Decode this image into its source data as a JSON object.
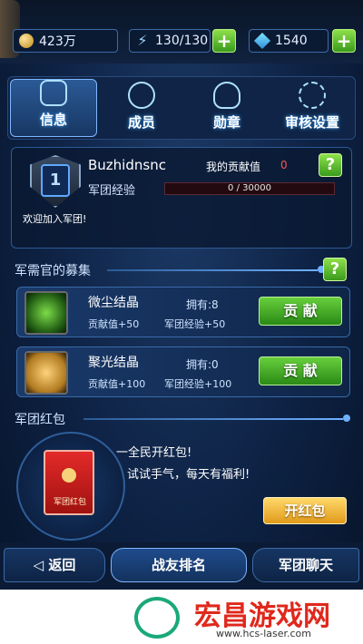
{
  "resources": {
    "gold": "423万",
    "stamina": "130/130",
    "gems": "1540"
  },
  "tabs": [
    {
      "label": "信息",
      "active": true
    },
    {
      "label": "成员",
      "active": false
    },
    {
      "label": "勋章",
      "active": false
    },
    {
      "label": "审核设置",
      "active": false
    }
  ],
  "legion": {
    "level": "1",
    "name": "Buzhidnsnc",
    "contribution_label": "我的贡献值",
    "contribution_value": "0",
    "exp_label": "军团经验",
    "exp_text": "0 / 30000",
    "exp_progress": 0,
    "welcome": "欢迎加入军团!"
  },
  "recruit": {
    "title": "军需官的募集",
    "items": [
      {
        "name": "微尘结晶",
        "owned": "拥有:8",
        "contribution": "贡献值+50",
        "exp": "军团经验+50",
        "button": "贡 献"
      },
      {
        "name": "聚光结晶",
        "owned": "拥有:0",
        "contribution": "贡献值+100",
        "exp": "军团经验+100",
        "button": "贡 献"
      }
    ]
  },
  "red_packet": {
    "title": "军团红包",
    "bag_label": "军团红包",
    "line1": "一全民开红包!",
    "line2": "试试手气，每天有福利!",
    "button": "开红包"
  },
  "bottom_nav": {
    "back": "返回",
    "ranking": "战友排名",
    "chat": "军团聊天"
  },
  "watermark": {
    "title": "宏昌游戏网",
    "url": "www.hcs-laser.com"
  },
  "colors": {
    "accent_green": "#5cc236",
    "accent_red": "#ff5555",
    "panel_border": "#3d6aa8"
  }
}
